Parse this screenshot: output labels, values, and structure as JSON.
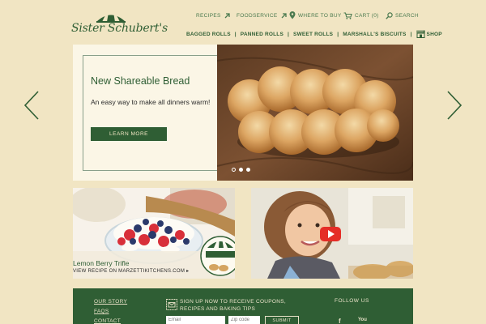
{
  "brand": {
    "name": "Sister Schubert's"
  },
  "utility_nav": {
    "recipes": "RECIPES",
    "foodservice": "FOODSERVICE",
    "where_to_buy": "WHERE TO BUY",
    "cart": "CART (0)",
    "search": "SEARCH"
  },
  "main_nav": {
    "items": [
      "BAGGED ROLLS",
      "PANNED ROLLS",
      "SWEET ROLLS",
      "MARSHALL'S BISCUITS"
    ],
    "shop": "SHOP"
  },
  "hero": {
    "title": "New Shareable Bread",
    "subtitle": "An easy way to make all dinners warm!",
    "button": "LEARN MORE",
    "slides_total": 3,
    "active_slide": 1
  },
  "tiles": {
    "left_caption": "Lemon Berry Trifle",
    "left_link": "VIEW RECIPE ON MARZETTIKITCHENS.COM"
  },
  "footer": {
    "links": [
      "OUR STORY",
      "FAQS",
      "CONTACT"
    ],
    "signup_text": "SIGN UP NOW TO RECEIVE COUPONS, RECIPES AND BAKING TIPS",
    "email_placeholder": "Email",
    "zip_placeholder": "Zip code",
    "submit": "SUBMIT",
    "follow": "FOLLOW US"
  },
  "colors": {
    "background": "#f1e5c3",
    "brand_green": "#2f5e34",
    "hero_panel": "#fbf6e6"
  }
}
